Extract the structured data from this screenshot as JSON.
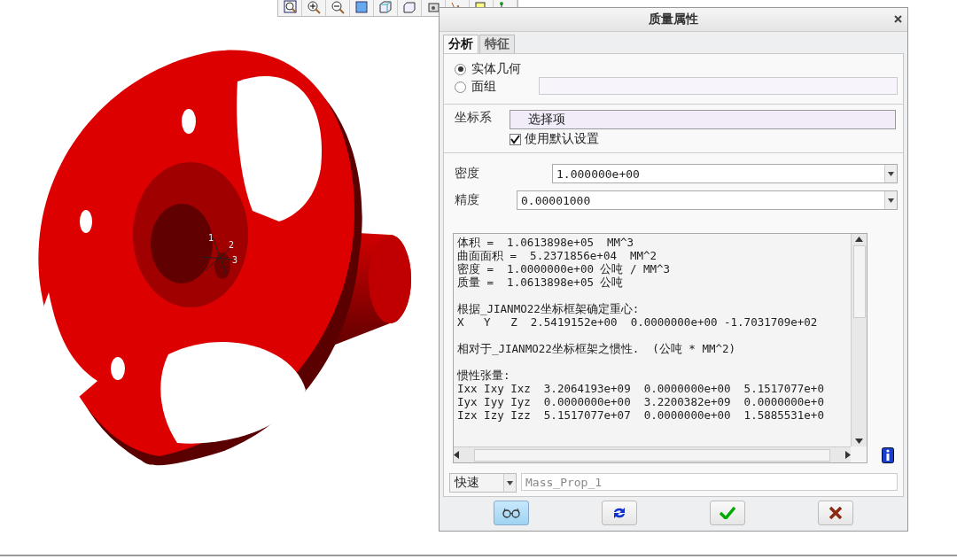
{
  "model": {
    "axis_labels": [
      "1",
      "2",
      "3"
    ]
  },
  "dialog": {
    "title": "质量属性",
    "tabs": [
      {
        "label": "分析",
        "selected": true
      },
      {
        "label": "特征",
        "selected": false
      }
    ],
    "geometry": [
      {
        "label": "实体几何",
        "selected": true
      },
      {
        "label": "面组",
        "selected": false
      }
    ],
    "coord_system": {
      "label": "坐标系",
      "value": "选择项"
    },
    "use_default": {
      "label": "使用默认设置",
      "checked": true
    },
    "density": {
      "label": "密度",
      "value": "1.000000e+00"
    },
    "precision": {
      "label": "精度",
      "value": "0.00001000"
    },
    "output_blocks": [
      [
        "体积 =  1.0613898e+05  MM^3",
        "曲面面积 =  5.2371856e+04  MM^2",
        "密度 =  1.0000000e+00 公吨 / MM^3",
        "质量 =  1.0613898e+05 公吨"
      ],
      [
        "根据_JIANMO22坐标框架确定重心:",
        "X   Y   Z  2.5419152e+00  0.0000000e+00 -1.7031709e+02"
      ],
      [
        "相对于_JIANMO22坐标框架之惯性.  (公吨 * MM^2)"
      ],
      [
        "惯性张量:",
        "Ixx Ixy Ixz  3.2064193e+09  0.0000000e+00  5.1517077e+0",
        "Iyx Iyy Iyz  0.0000000e+00  3.2200382e+09  0.0000000e+0",
        "Izx Izy Izz  5.1517077e+07  0.0000000e+00  1.5885531e+0"
      ]
    ],
    "mode": {
      "value": "快速"
    },
    "name_field": {
      "placeholder": "Mass_Prop_1"
    },
    "buttons": [
      {
        "kind": "preview",
        "pressed": true
      },
      {
        "kind": "repaint",
        "pressed": false
      },
      {
        "kind": "ok",
        "pressed": false
      },
      {
        "kind": "cancel",
        "pressed": false
      }
    ]
  }
}
